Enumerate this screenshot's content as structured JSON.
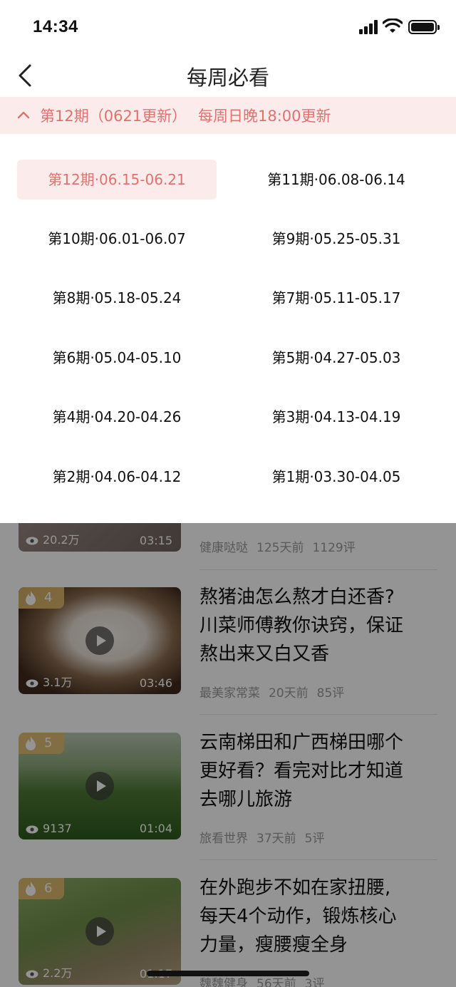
{
  "status_bar": {
    "time": "14:34"
  },
  "nav": {
    "title": "每周必看"
  },
  "issue_bar": {
    "current": "第12期（0621更新）",
    "schedule": "每周日晚18:00更新"
  },
  "issues": [
    {
      "label": "第12期·06.15-06.21",
      "active": true
    },
    {
      "label": "第11期·06.08-06.14"
    },
    {
      "label": "第10期·06.01-06.07"
    },
    {
      "label": "第9期·05.25-05.31"
    },
    {
      "label": "第8期·05.18-05.24"
    },
    {
      "label": "第7期·05.11-05.17"
    },
    {
      "label": "第6期·05.04-05.10"
    },
    {
      "label": "第5期·04.27-05.03"
    },
    {
      "label": "第4期·04.20-04.26"
    },
    {
      "label": "第3期·04.13-04.19"
    },
    {
      "label": "第2期·04.06-04.12"
    },
    {
      "label": "第1期·03.30-04.05"
    }
  ],
  "feed": [
    {
      "views": "20.2万",
      "duration": "03:15",
      "author": "健康哒哒",
      "time": "125天前",
      "comments": "1129评"
    },
    {
      "rank": "4",
      "title_lines": [
        "熬猪油怎么熬才白还香?",
        "川菜师傅教你诀窍，保证",
        "熬出来又白又香"
      ],
      "views": "3.1万",
      "duration": "03:46",
      "author": "最美家常菜",
      "time": "20天前",
      "comments": "85评"
    },
    {
      "rank": "5",
      "title_lines": [
        "云南梯田和广西梯田哪个",
        "更好看？看完对比才知道",
        "去哪儿旅游"
      ],
      "views": "9137",
      "duration": "01:04",
      "author": "旅看世界",
      "time": "37天前",
      "comments": "5评"
    },
    {
      "rank": "6",
      "title_lines": [
        "在外跑步不如在家扭腰,",
        "每天4个动作，锻炼核心",
        "力量，瘦腰瘦全身"
      ],
      "views": "2.2万",
      "duration": "01:17",
      "author": "魏魏健身",
      "time": "56天前",
      "comments": "3评"
    }
  ]
}
